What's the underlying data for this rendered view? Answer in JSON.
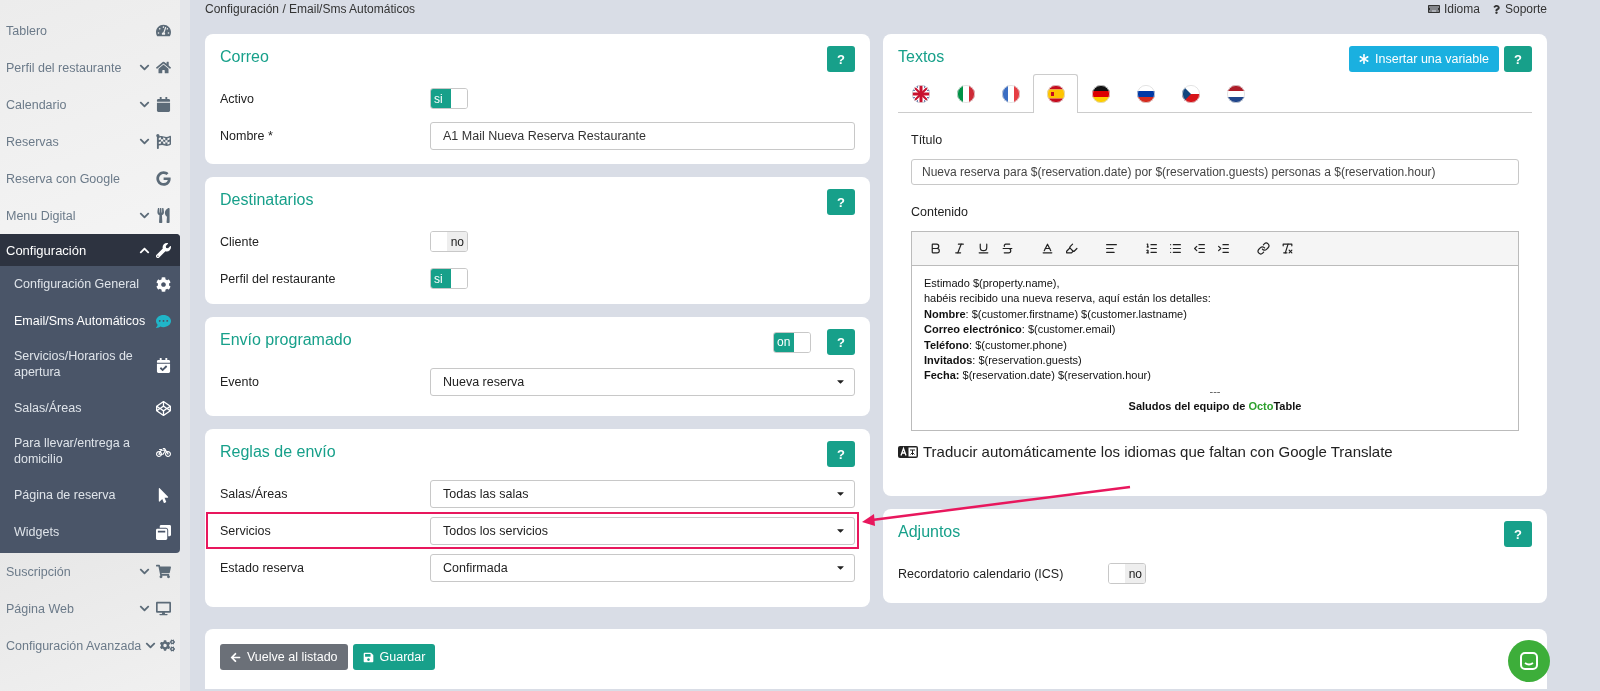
{
  "topbar": {
    "breadcrumb": "Configuración / Email/Sms Automáticos",
    "links": [
      "Idioma",
      "Soporte"
    ]
  },
  "sidebar": {
    "items": [
      {
        "label": "Tablero",
        "kind": "link"
      },
      {
        "label": "Perfil del restaurante",
        "kind": "group",
        "expanded": false
      },
      {
        "label": "Calendario",
        "kind": "group",
        "expanded": false
      },
      {
        "label": "Reservas",
        "kind": "group",
        "expanded": false
      },
      {
        "label": "Reserva con Google",
        "kind": "link"
      },
      {
        "label": "Menu Digital",
        "kind": "group",
        "expanded": false
      },
      {
        "label": "Configuración",
        "kind": "group",
        "expanded": true,
        "children": [
          {
            "label": "Configuración General",
            "selected": false
          },
          {
            "label": "Email/Sms Automáticos",
            "selected": true
          },
          {
            "label": "Servicios/Horarios de apertura",
            "selected": false
          },
          {
            "label": "Salas/Áreas",
            "selected": false
          },
          {
            "label": "Para llevar/entrega a domicilio",
            "selected": false
          },
          {
            "label": "Página de reserva",
            "selected": false
          },
          {
            "label": "Widgets",
            "selected": false
          }
        ]
      },
      {
        "label": "Suscripción",
        "kind": "group",
        "expanded": false
      },
      {
        "label": "Página Web",
        "kind": "group",
        "expanded": false
      },
      {
        "label": "Configuración Avanzada",
        "kind": "group",
        "expanded": false
      }
    ]
  },
  "correo": {
    "title": "Correo",
    "help": "?",
    "activo": {
      "label": "Activo",
      "on": true,
      "text": "si"
    },
    "nombre": {
      "label": "Nombre",
      "required": "*",
      "value": "A1 Mail Nueva Reserva Restaurante"
    }
  },
  "destinatarios": {
    "title": "Destinatarios",
    "help": "?",
    "toggles": [
      {
        "label": "Cliente",
        "on": false,
        "text": "no"
      },
      {
        "label": "Perfil del restaurante",
        "on": true,
        "text": "si"
      }
    ]
  },
  "envio_programado": {
    "title": "Envío programado",
    "help": "?",
    "toggle": {
      "on": true,
      "text": "on"
    },
    "evento": {
      "label": "Evento",
      "value": "Nueva reserva"
    }
  },
  "reglas_de_envio": {
    "title": "Reglas de envío",
    "help": "?",
    "rules": [
      {
        "label": "Salas/Áreas",
        "value": "Todas las salas",
        "highlighted": false
      },
      {
        "label": "Servicios",
        "value": "Todos los servicios",
        "highlighted": true
      },
      {
        "label": "Estado reserva",
        "value": "Confirmada",
        "highlighted": false
      }
    ]
  },
  "actions": {
    "back": "Vuelve al listado",
    "save": "Guardar"
  },
  "textos": {
    "title": "Textos",
    "insert_variable": "Insertar una variable",
    "help": "?",
    "languages": [
      {
        "kind": "uk",
        "selected": false
      },
      {
        "kind": "it",
        "selected": false
      },
      {
        "kind": "fr",
        "selected": false
      },
      {
        "kind": "es",
        "selected": true
      },
      {
        "kind": "de",
        "selected": false
      },
      {
        "kind": "ru",
        "selected": false
      },
      {
        "kind": "cz",
        "selected": false
      },
      {
        "kind": "nl",
        "selected": false
      }
    ],
    "titulo": {
      "label": "Título",
      "value": "Nueva reserva para $(reservation.date) por $(reservation.guests) personas a $(reservation.hour)"
    },
    "contenido": {
      "label": "Contenido",
      "lines": [
        "Estimado $(property.name),",
        "habéis recibido una nueva reserva, aquí están los detalles:",
        "**Nombre**: $(customer.firstname) $(customer.lastname)",
        "**Correo electrónico**: $(customer.email)",
        "**Teléfono**: $(customer.phone)",
        "**Invitados**: $(reservation.guests)",
        "**Fecha:** $(reservation.date) $(reservation.hour)"
      ],
      "separator": "---",
      "signature": [
        {
          "text": "Saludos del equipo de ",
          "color": "#111111"
        },
        {
          "text": "Octo",
          "color": "#2ea02e"
        },
        {
          "text": "Table",
          "color": "#111111"
        }
      ]
    },
    "translate": "Traducir automáticamente los idiomas que faltan con Google Translate"
  },
  "adjuntos": {
    "title": "Adjuntos",
    "help": "?",
    "toggle": {
      "label": "Recordatorio calendario (ICS)",
      "on": false,
      "text": "no"
    }
  }
}
